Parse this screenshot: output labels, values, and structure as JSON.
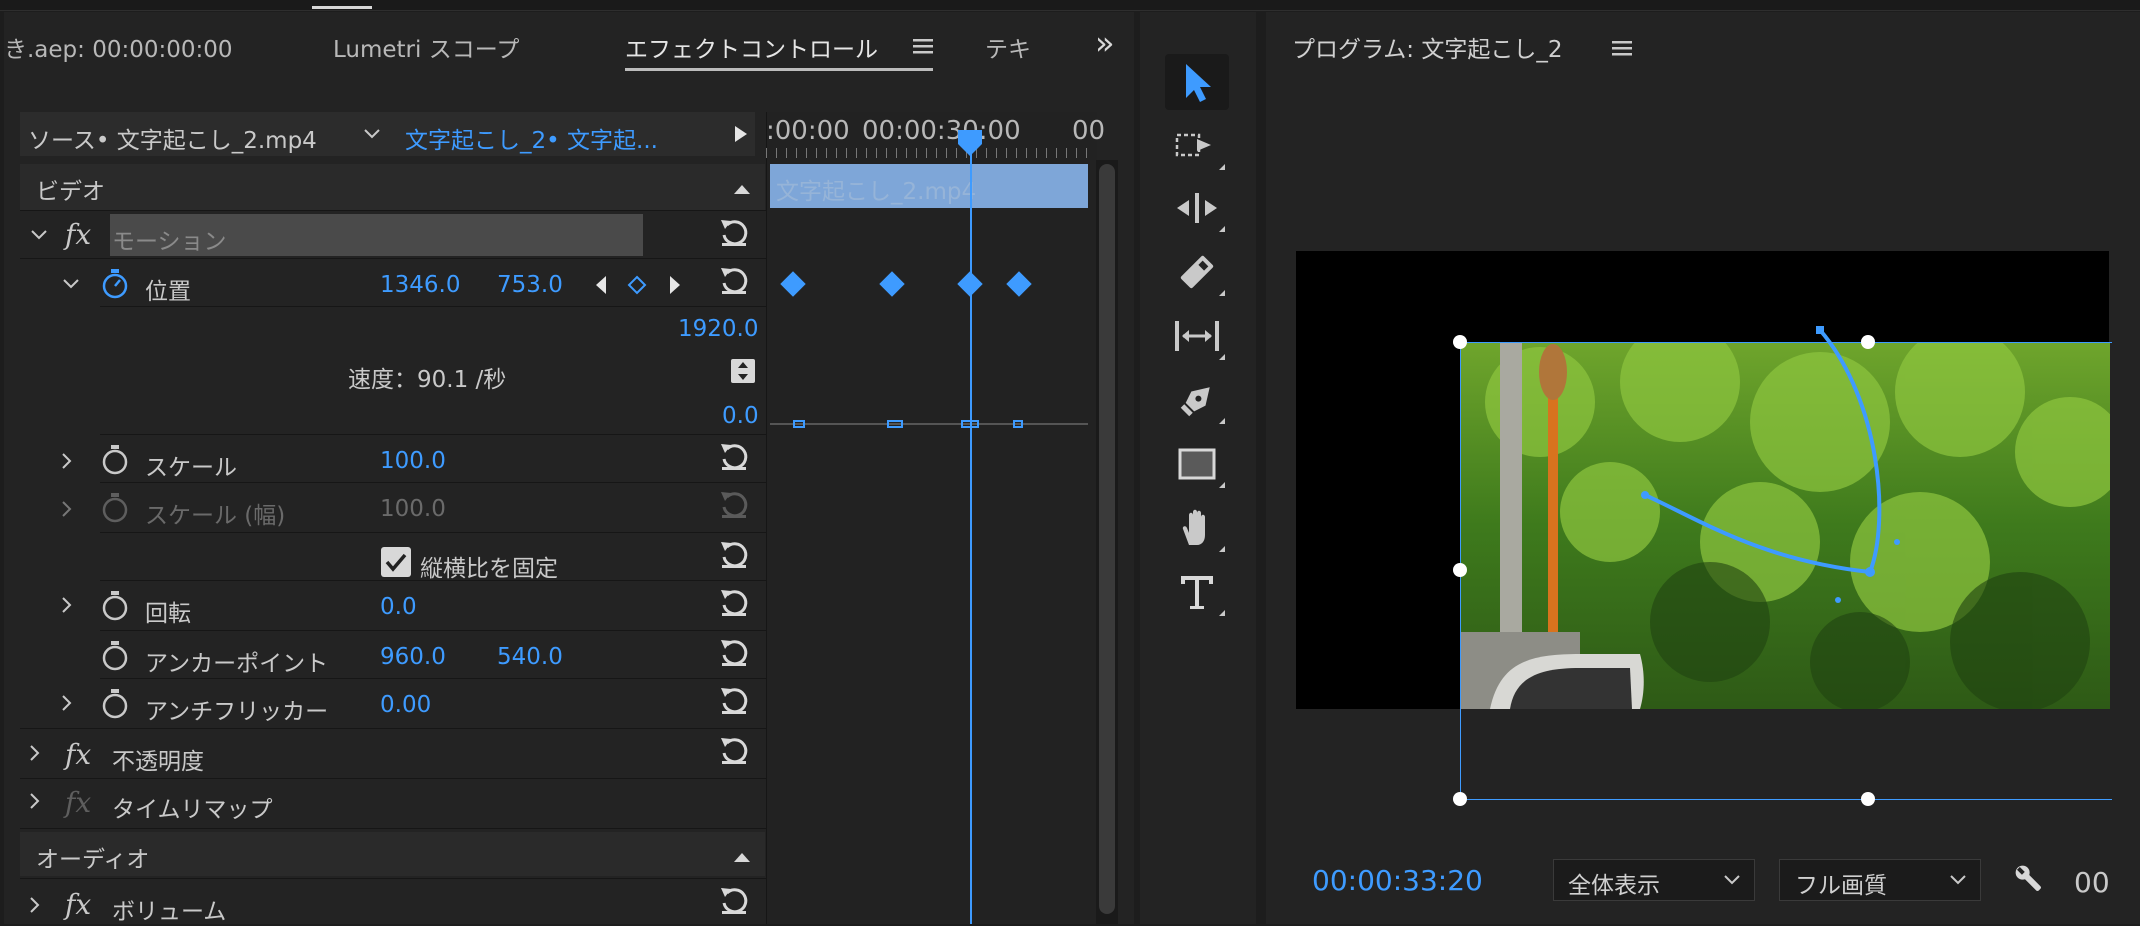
{
  "tabs": {
    "tab1": "き.aep: 00:00:00:00",
    "tab2": "Lumetri スコープ",
    "tab3": "エフェクトコントロール",
    "tab4": "テキ",
    "more": "»"
  },
  "source_bar": {
    "source": "ソース• 文字起こし_2.mp4",
    "sequence": "文字起こし_2• 文字起..."
  },
  "timeline": {
    "tick1": ":00:00",
    "tick2": "00:00:30:00",
    "tick3": "00",
    "clip_label": "文字起こし_2.mp4"
  },
  "sections": {
    "video": "ビデオ",
    "audio": "オーディオ"
  },
  "effects": {
    "motion": "モーション",
    "position": {
      "label": "位置",
      "x": "1346.0",
      "y": "753.0"
    },
    "graph_max": "1920.0",
    "speed": "速度：90.1 /秒",
    "graph_min": "0.0",
    "scale": {
      "label": "スケール",
      "value": "100.0"
    },
    "scale_width": {
      "label": "スケール (幅)",
      "value": "100.0"
    },
    "uniform_scale": "縦横比を固定",
    "rotation": {
      "label": "回転",
      "value": "0.0"
    },
    "anchor": {
      "label": "アンカーポイント",
      "x": "960.0",
      "y": "540.0"
    },
    "antiflicker": {
      "label": "アンチフリッカー",
      "value": "0.00"
    },
    "opacity": "不透明度",
    "timeremap": "タイムリマップ",
    "volume": "ボリューム"
  },
  "program": {
    "title": "プログラム: 文字起こし_2",
    "timecode": "00:00:33:20",
    "fit": "全体表示",
    "quality": "フル画質",
    "extra": "00"
  },
  "tools": [
    "selection-tool",
    "track-select-tool",
    "ripple-edit-tool",
    "razor-tool",
    "slip-tool",
    "pen-tool",
    "rectangle-tool",
    "hand-tool",
    "type-tool"
  ],
  "colors": {
    "accent": "#3e9bff",
    "panel": "#232323",
    "clip": "#7ea6d8"
  }
}
